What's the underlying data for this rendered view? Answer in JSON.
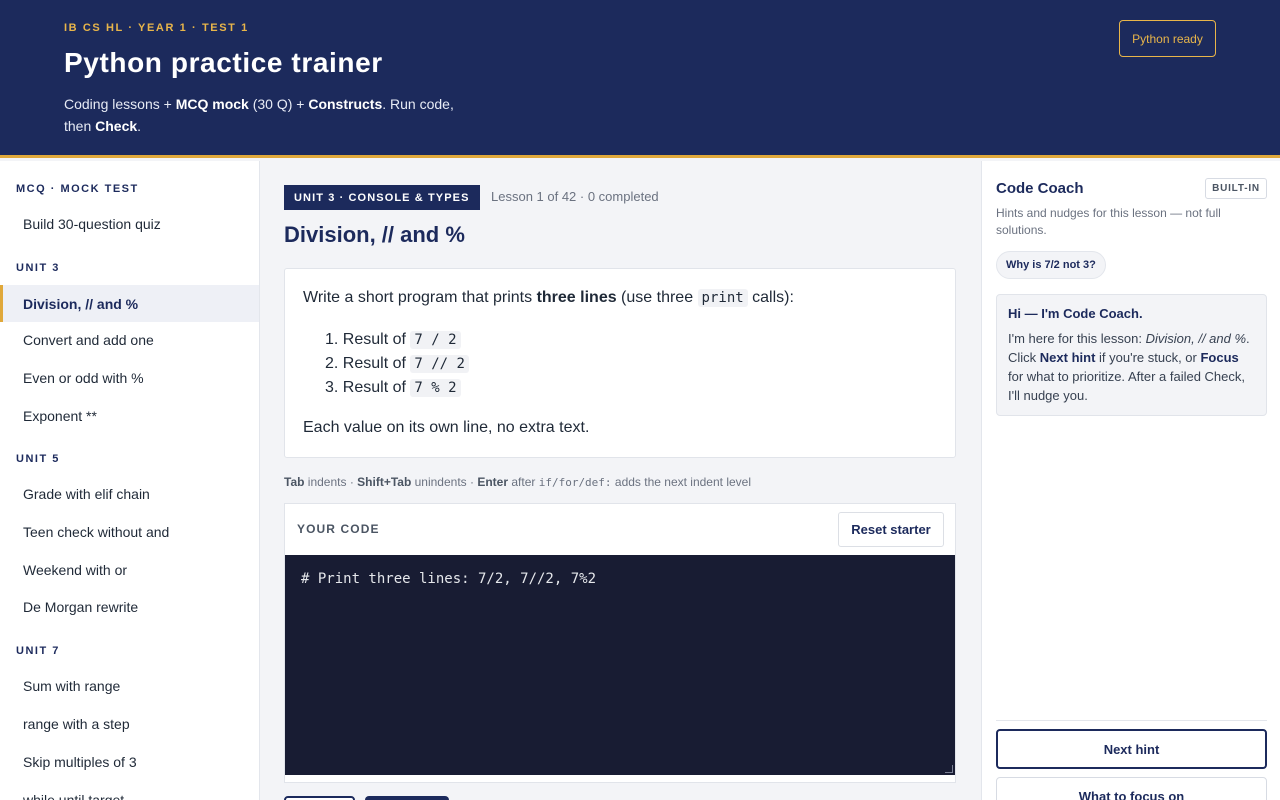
{
  "header": {
    "eyebrow": "IB CS HL · YEAR 1 · TEST 1",
    "title": "Python practice trainer",
    "subtitle": {
      "t1": "Coding lessons + ",
      "b1": "MCQ mock",
      "t2": " (30 Q) + ",
      "b2": "Constructs",
      "t3": ". Run code, then ",
      "b3": "Check",
      "t4": "."
    },
    "status": "Python ready"
  },
  "sidebar": {
    "sections": [
      {
        "heading": "MCQ · MOCK TEST",
        "items": [
          "Build 30-question quiz"
        ]
      },
      {
        "heading": "UNIT 3",
        "items": [
          "Division, // and %",
          "Convert and add one",
          "Even or odd with %",
          "Exponent **"
        ]
      },
      {
        "heading": "UNIT 5",
        "items": [
          "Grade with elif chain",
          "Teen check without and",
          "Weekend with or",
          "De Morgan rewrite"
        ]
      },
      {
        "heading": "UNIT 7",
        "items": [
          "Sum with range",
          "range with a step",
          "Skip multiples of 3",
          "while until target"
        ]
      }
    ],
    "active_item": "Division, // and %"
  },
  "lesson": {
    "badge": "UNIT 3 · CONSOLE & TYPES",
    "meta": "Lesson 1 of 42 · 0 completed",
    "title": "Division, // and %",
    "task": {
      "intro_1": "Write a short program that prints ",
      "intro_bold": "three lines",
      "intro_2": " (use three ",
      "intro_code": "print",
      "intro_3": " calls):",
      "items": [
        {
          "num": "1.",
          "label": "Result of ",
          "code": "7 / 2"
        },
        {
          "num": "2.",
          "label": "Result of ",
          "code": "7 // 2"
        },
        {
          "num": "3.",
          "label": "Result of ",
          "code": "7 % 2"
        }
      ],
      "footer": "Each value on its own line, no extra text."
    }
  },
  "editor_hint": {
    "k1": "Tab",
    "t1": " indents · ",
    "k2": "Shift+Tab",
    "t2": " unindents · ",
    "k3": "Enter",
    "t3": " after ",
    "code": "if/for/def:",
    "t4": " adds the next indent level"
  },
  "editor": {
    "label": "YOUR CODE",
    "reset_label": "Reset starter",
    "code": "# Print three lines: 7/2, 7//2, 7%2"
  },
  "coach": {
    "title": "Code Coach",
    "badge": "BUILT-IN",
    "description": "Hints and nudges for this lesson — not full solutions.",
    "chip": "Why is 7/2 not 3?",
    "message": {
      "heading": "Hi — I'm Code Coach.",
      "t1": "I'm here for this lesson: ",
      "lesson_em": "Division, // and %",
      "t2": ". Click ",
      "b1": "Next hint",
      "t3": " if you're stuck, or ",
      "b2": "Focus",
      "t4": " for what to prioritize. After a failed Check, I'll nudge you."
    },
    "next_hint": "Next hint",
    "focus": "What to focus on"
  },
  "colors": {
    "navy": "#1c2a5c",
    "accent": "#e0a83a",
    "editor_bg": "#181c33"
  }
}
